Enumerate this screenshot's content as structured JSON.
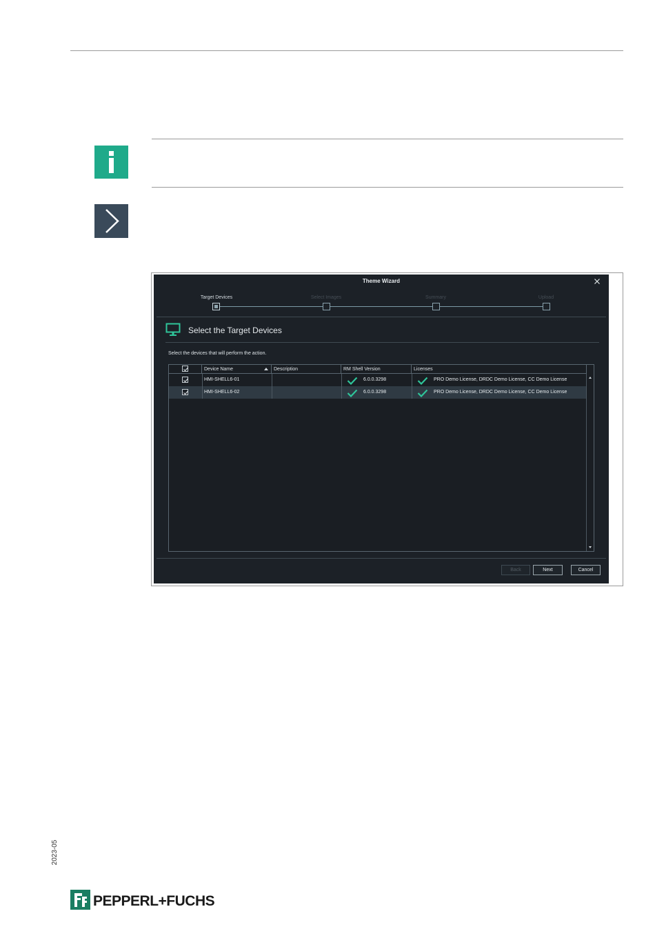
{
  "wizard": {
    "title": "Theme Wizard",
    "steps": [
      {
        "label": "Target Devices",
        "active": true
      },
      {
        "label": "Select Images",
        "active": false
      },
      {
        "label": "Summary",
        "active": false
      },
      {
        "label": "Upload",
        "active": false
      }
    ],
    "section_title": "Select the Target Devices",
    "description": "Select the devices that will perform the action.",
    "columns": [
      "Device Name",
      "Description",
      "RM Shell Version",
      "Licenses"
    ],
    "rows": [
      {
        "checked": true,
        "device_name": "HMI-SHELL6-01",
        "description": "",
        "version": "6.0.0.3298",
        "licenses": "PRO Demo License, DRDC Demo License, CC Demo License",
        "selected": false
      },
      {
        "checked": true,
        "device_name": "HMI-SHELL6-02",
        "description": "",
        "version": "6.0.0.3298",
        "licenses": "PRO Demo License, DRDC Demo License, CC Demo License",
        "selected": true
      }
    ],
    "buttons": {
      "back": "Back",
      "next": "Next",
      "cancel": "Cancel"
    }
  },
  "side_label": "2023-05",
  "brand": {
    "name": "PEPPERL+FUCHS",
    "color": "#1a7e62"
  },
  "colors": {
    "info": "#1faa8a",
    "step_marker": "#3a4a5a",
    "check": "#2fc59a",
    "window_bg": "#1c2127"
  },
  "icons": {
    "note": "info-icon",
    "step": "chevron-right-icon",
    "section": "monitor-icon",
    "close": "close-icon"
  }
}
